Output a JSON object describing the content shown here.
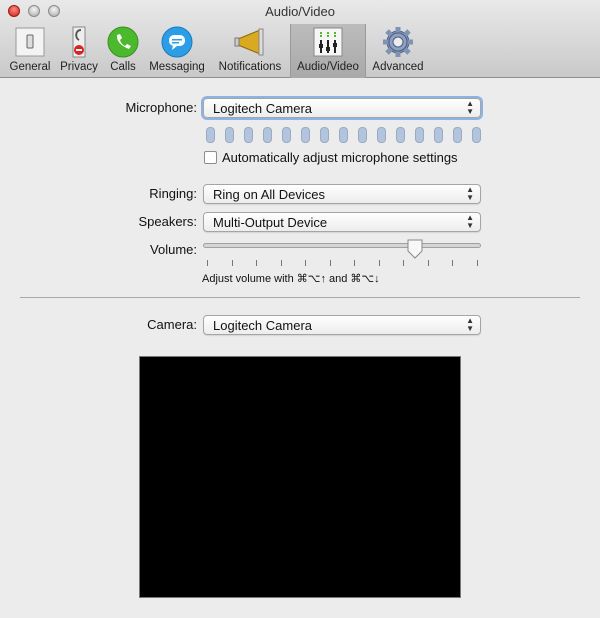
{
  "window": {
    "title": "Audio/Video"
  },
  "toolbar": [
    {
      "label": "General",
      "icon": "general-switch-icon"
    },
    {
      "label": "Privacy",
      "icon": "privacy-icon"
    },
    {
      "label": "Calls",
      "icon": "phone-icon"
    },
    {
      "label": "Messaging",
      "icon": "chat-bubble-icon"
    },
    {
      "label": "Notifications",
      "icon": "megaphone-icon"
    },
    {
      "label": "Audio/Video",
      "icon": "mixer-icon",
      "selected": true
    },
    {
      "label": "Advanced",
      "icon": "gear-icon"
    }
  ],
  "audio": {
    "microphone_label": "Microphone:",
    "microphone_value": "Logitech Camera",
    "mic_level_segments": 15,
    "mic_level": 0,
    "auto_adjust_label": "Automatically adjust microphone settings",
    "auto_adjust_checked": false,
    "ringing_label": "Ringing:",
    "ringing_value": "Ring on All Devices",
    "speakers_label": "Speakers:",
    "speakers_value": "Multi-Output Device",
    "volume_label": "Volume:",
    "volume_fraction": 0.78,
    "volume_hint": "Adjust volume with ⌘⌥↑ and ⌘⌥↓"
  },
  "video": {
    "camera_label": "Camera:",
    "camera_value": "Logitech Camera"
  }
}
